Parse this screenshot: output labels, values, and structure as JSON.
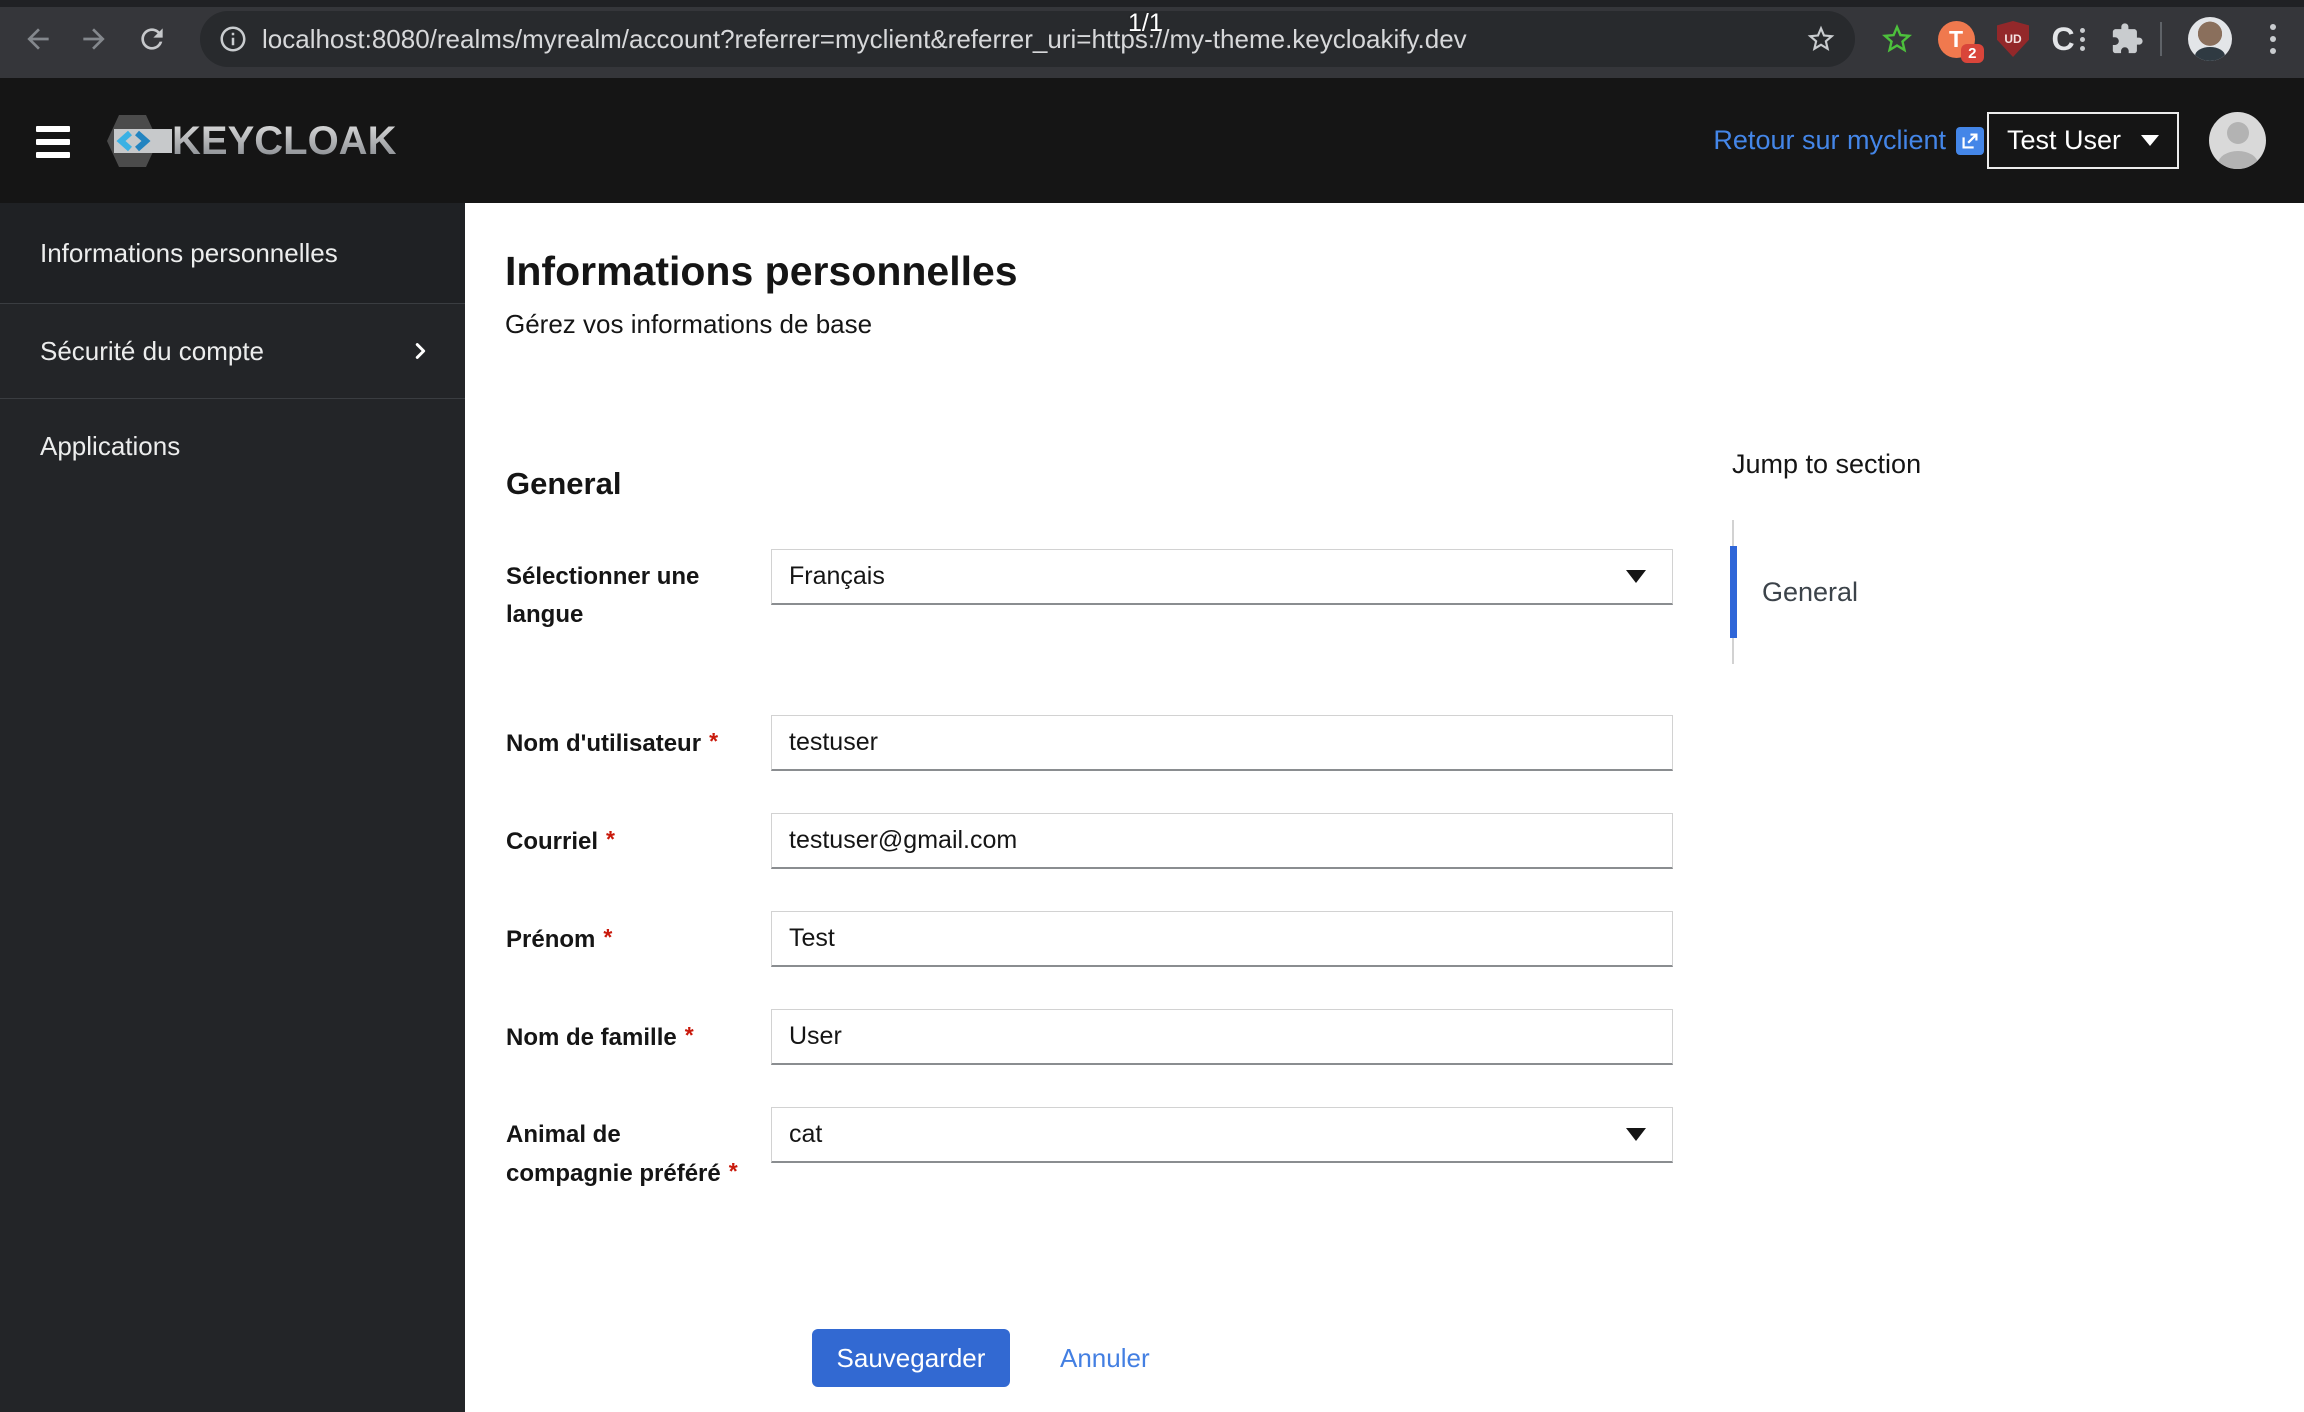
{
  "browser": {
    "url": "localhost:8080/realms/myrealm/account?referrer=myclient&referrer_uri=https://my-theme.keycloakify.dev",
    "page_indicator": "1/1",
    "extensions": {
      "tampermonkey_letter": "T",
      "tampermonkey_badge": "2",
      "shield_label": "UD",
      "c_label": "C"
    }
  },
  "header": {
    "brand": "KEYCLOAK",
    "back_link": "Retour sur myclient",
    "user_name": "Test User"
  },
  "sidebar": {
    "items": [
      {
        "label": "Informations personnelles",
        "active": true
      },
      {
        "label": "Sécurité du compte",
        "expandable": true
      },
      {
        "label": "Applications"
      }
    ]
  },
  "main": {
    "title": "Informations personnelles",
    "subtitle": "Gérez vos informations de base",
    "section_heading": "General",
    "required_marker": "*",
    "fields": [
      {
        "label": "Sélectionner une langue",
        "value": "Français",
        "type": "select",
        "required": false
      },
      {
        "label": "Nom d'utilisateur",
        "value": "testuser",
        "type": "text",
        "required": true
      },
      {
        "label": "Courriel",
        "value": "testuser@gmail.com",
        "type": "text",
        "required": true
      },
      {
        "label": "Prénom",
        "value": "Test",
        "type": "text",
        "required": true
      },
      {
        "label": "Nom de famille",
        "value": "User",
        "type": "text",
        "required": true
      },
      {
        "label": "Animal de compagnie préféré",
        "value": "cat",
        "type": "select",
        "required": true
      }
    ],
    "save_label": "Sauvegarder",
    "cancel_label": "Annuler"
  },
  "jump": {
    "heading": "Jump to section",
    "items": [
      {
        "label": "General",
        "active": true
      }
    ]
  },
  "colors": {
    "accent": "#3269d2",
    "link": "#4486e8",
    "danger": "#c9190b",
    "masthead": "#151515",
    "sidebar": "#232528",
    "sidebar_active": "#1f2124",
    "chrome": "#35363a",
    "omnibox": "#282a2d"
  }
}
